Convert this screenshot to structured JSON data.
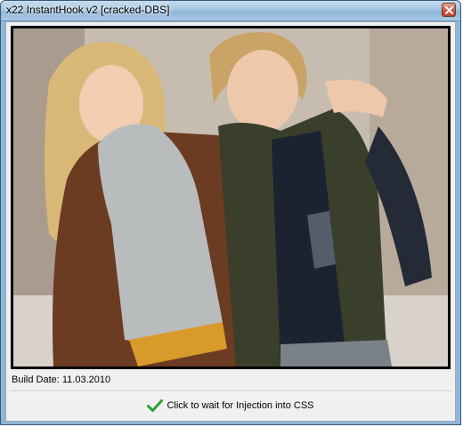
{
  "window": {
    "title": "x22 InstantHook v2 [cracked-DBS]"
  },
  "image": {
    "description_icon": "photo-image"
  },
  "status": {
    "build_date": "Build Date: 11.03.2010"
  },
  "action": {
    "label": "Click to wait for Injection into CSS",
    "icon": "checkmark-icon"
  },
  "colors": {
    "titlebar": "#9ec3e2",
    "check": "#2f9e2f"
  }
}
